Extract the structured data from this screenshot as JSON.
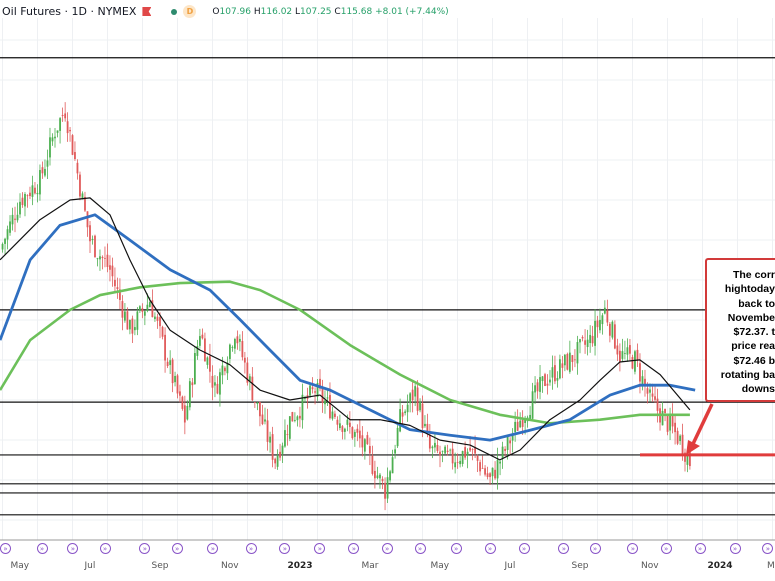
{
  "header": {
    "symbol": "Oil Futures · 1D · NYMEX",
    "interval_badge": "D",
    "open": "107.96",
    "high": "116.02",
    "low": "107.25",
    "close": "115.68",
    "change": "+8.01 (+7.44%)",
    "o_label": "O",
    "h_label": "H",
    "l_label": "L",
    "c_label": "C"
  },
  "annotation": {
    "lines": [
      "The corr",
      "hightoday",
      "back to",
      "Novembe",
      "$72.37.  t",
      "price rea",
      "$72.46 b",
      "rotating ba",
      "downs"
    ]
  },
  "x_axis": [
    {
      "label": "May",
      "t": 0
    },
    {
      "label": "Jul",
      "t": 2
    },
    {
      "label": "Sep",
      "t": 4
    },
    {
      "label": "Nov",
      "t": 6
    },
    {
      "label": "2023",
      "t": 8,
      "year": true
    },
    {
      "label": "Mar",
      "t": 10
    },
    {
      "label": "May",
      "t": 12
    },
    {
      "label": "Jul",
      "t": 14
    },
    {
      "label": "Sep",
      "t": 16
    },
    {
      "label": "Nov",
      "t": 18
    },
    {
      "label": "2024",
      "t": 20,
      "year": true
    },
    {
      "label": "M",
      "t": 21.7
    }
  ],
  "colors": {
    "up": "#4caf50",
    "down": "#e05a5a",
    "ma50": "#111111",
    "ma100": "#2f6fc0",
    "ma200": "#6cc05a",
    "level": "#111111",
    "accent": "#e03c3c"
  },
  "chart_data": {
    "type": "candlestick",
    "x_unit": "months since May 2022",
    "price_keypoints": [
      [
        -0.57,
        102.1
      ],
      [
        0,
        109.2
      ],
      [
        0.57,
        112.0
      ],
      [
        1,
        119.1
      ],
      [
        1.29,
        122.0
      ],
      [
        1.57,
        114.9
      ],
      [
        2,
        103.5
      ],
      [
        2.57,
        99.3
      ],
      [
        3.14,
        90.7
      ],
      [
        3.71,
        95.0
      ],
      [
        4.29,
        85.1
      ],
      [
        4.71,
        78.0
      ],
      [
        5.14,
        90.7
      ],
      [
        5.57,
        82.2
      ],
      [
        6.14,
        90.7
      ],
      [
        6.71,
        80.8
      ],
      [
        7.29,
        72.3
      ],
      [
        7.71,
        78.0
      ],
      [
        8.43,
        82.2
      ],
      [
        9.14,
        78.0
      ],
      [
        9.71,
        75.1
      ],
      [
        10.14,
        70.9
      ],
      [
        10.43,
        68.0
      ],
      [
        10.86,
        78.0
      ],
      [
        11.29,
        82.2
      ],
      [
        11.71,
        73.7
      ],
      [
        12.29,
        72.3
      ],
      [
        12.86,
        73.7
      ],
      [
        13.43,
        69.4
      ],
      [
        13.86,
        73.7
      ],
      [
        14.29,
        78.0
      ],
      [
        15,
        83.6
      ],
      [
        15.71,
        86.5
      ],
      [
        16.29,
        89.3
      ],
      [
        16.71,
        93.6
      ],
      [
        17.14,
        87.2
      ],
      [
        17.57,
        86.5
      ],
      [
        18,
        80.8
      ],
      [
        18.43,
        78.0
      ],
      [
        18.86,
        75.1
      ],
      [
        19.14,
        72.0
      ]
    ],
    "ma50": [
      [
        -0.57,
        100.7
      ],
      [
        0.57,
        106.4
      ],
      [
        1.43,
        109.2
      ],
      [
        2,
        109.5
      ],
      [
        2.57,
        107.1
      ],
      [
        3.14,
        100.7
      ],
      [
        3.71,
        95
      ],
      [
        4.29,
        90.7
      ],
      [
        5.14,
        87.9
      ],
      [
        6,
        85.8
      ],
      [
        6.86,
        82.2
      ],
      [
        7.71,
        80.8
      ],
      [
        8.57,
        81.5
      ],
      [
        9.43,
        78
      ],
      [
        10.29,
        78
      ],
      [
        11.14,
        77.2
      ],
      [
        12,
        75.1
      ],
      [
        12.86,
        74.4
      ],
      [
        13.71,
        72.3
      ],
      [
        14.29,
        73.7
      ],
      [
        15.14,
        78
      ],
      [
        16,
        80.8
      ],
      [
        16.57,
        83.6
      ],
      [
        17.14,
        86.2
      ],
      [
        17.71,
        86.5
      ],
      [
        18.29,
        84.4
      ],
      [
        19.14,
        79.4
      ]
    ],
    "ma100": [
      [
        -0.57,
        89.3
      ],
      [
        0.29,
        100.7
      ],
      [
        1.14,
        105.6
      ],
      [
        2.14,
        107.1
      ],
      [
        3.14,
        103.5
      ],
      [
        4.29,
        99.3
      ],
      [
        5.43,
        96.4
      ],
      [
        6.29,
        92.2
      ],
      [
        7.14,
        87.9
      ],
      [
        8,
        83.6
      ],
      [
        8.86,
        82.2
      ],
      [
        10,
        79.4
      ],
      [
        11.14,
        76.6
      ],
      [
        12.29,
        75.8
      ],
      [
        13.43,
        75.1
      ],
      [
        14.57,
        76.5
      ],
      [
        15.71,
        78
      ],
      [
        16.86,
        81.5
      ],
      [
        17.71,
        82.9
      ],
      [
        18.57,
        82.9
      ],
      [
        19.29,
        82.2
      ]
    ],
    "ma200": [
      [
        -0.57,
        82.2
      ],
      [
        0.29,
        89.3
      ],
      [
        1.43,
        93.6
      ],
      [
        2.29,
        95.7
      ],
      [
        3.43,
        96.8
      ],
      [
        4.57,
        97.4
      ],
      [
        6,
        97.6
      ],
      [
        6.86,
        96.4
      ],
      [
        8,
        93.6
      ],
      [
        9.43,
        88.6
      ],
      [
        10.86,
        84.4
      ],
      [
        12.29,
        80.8
      ],
      [
        13.71,
        78.7
      ],
      [
        15.14,
        77.5
      ],
      [
        16.57,
        78
      ],
      [
        17.71,
        78.7
      ],
      [
        19.14,
        78.7
      ]
    ],
    "levels": [
      129.4,
      93.6,
      80.5,
      73.0,
      68.9,
      67.6,
      64.5
    ],
    "highlight_level": 73.0,
    "events_t": [
      -0.45,
      0.63,
      1.51,
      2.43,
      3.57,
      4.49,
      5.51,
      6.6,
      7.57,
      8.57,
      9.54,
      10.49,
      11.43,
      12.46,
      13.43,
      14.4,
      15.54,
      16.43,
      17.51,
      18.46,
      19.43,
      20.43,
      21.37
    ]
  }
}
